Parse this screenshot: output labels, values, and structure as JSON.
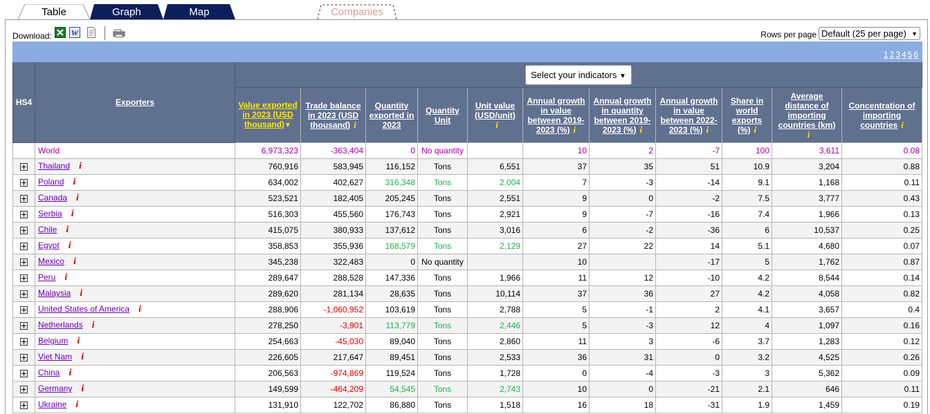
{
  "tabs": [
    {
      "label": "Table"
    },
    {
      "label": "Graph"
    },
    {
      "label": "Map"
    },
    {
      "label": "Companies"
    }
  ],
  "toolbar": {
    "download_label": "Download:",
    "rows_per_page_label": "Rows per page",
    "rows_per_page_value": "Default (25 per page)"
  },
  "pagination": [
    "1",
    "2",
    "3",
    "4",
    "5",
    "6"
  ],
  "select_indicators_label": "Select your indicators",
  "headers": {
    "hs4": "HS4",
    "exporters": "Exporters",
    "value_exported": "Value exported in 2023 (USD thousand)",
    "trade_balance": "Trade balance in 2023 (USD thousand)",
    "quantity_exported": "Quantity exported in 2023",
    "quantity_unit": "Quantity Unit",
    "unit_value": "Unit value (USD/unit)",
    "growth_value": "Annual growth in value between 2019-2023 (%)",
    "growth_quantity": "Annual growth in quantity between 2019-2023 (%)",
    "growth_value_2022": "Annual growth in value between 2022-2023 (%)",
    "share_world": "Share in world exports (%)",
    "avg_distance": "Average distance of importing countries (km)",
    "concentration": "Concentration of importing countries"
  },
  "colors": {
    "header_bg": "#60708f",
    "pager_bg": "#8aace1",
    "world_text": "#a200a6",
    "negative": "#e00000",
    "estimated": "#22b14c",
    "link": "#6b00b1",
    "sort_highlight": "#ffe600"
  },
  "rows": [
    {
      "name": "World",
      "value": "6,973,323",
      "balance": "-363,404",
      "qty": "0",
      "unit": "No quantity",
      "uv": "",
      "g1": "10",
      "g2": "2",
      "g3": "-7",
      "share": "100",
      "dist": "3,611",
      "conc": "0.08"
    },
    {
      "name": "Thailand",
      "value": "760,916",
      "balance": "583,945",
      "qty": "116,152",
      "unit": "Tons",
      "uv": "6,551",
      "g1": "37",
      "g2": "35",
      "g3": "51",
      "share": "10.9",
      "dist": "3,204",
      "conc": "0.88"
    },
    {
      "name": "Poland",
      "value": "634,002",
      "balance": "402,627",
      "qty": "316,348",
      "unit": "Tons",
      "uv": "2,004",
      "g1": "7",
      "g2": "-3",
      "g3": "-14",
      "share": "9.1",
      "dist": "1,168",
      "conc": "0.11"
    },
    {
      "name": "Canada",
      "value": "523,521",
      "balance": "182,405",
      "qty": "205,245",
      "unit": "Tons",
      "uv": "2,551",
      "g1": "9",
      "g2": "0",
      "g3": "-2",
      "share": "7.5",
      "dist": "3,777",
      "conc": "0.43"
    },
    {
      "name": "Serbia",
      "value": "516,303",
      "balance": "455,560",
      "qty": "176,743",
      "unit": "Tons",
      "uv": "2,921",
      "g1": "9",
      "g2": "-7",
      "g3": "-16",
      "share": "7.4",
      "dist": "1,966",
      "conc": "0.13"
    },
    {
      "name": "Chile",
      "value": "415,075",
      "balance": "380,933",
      "qty": "137,612",
      "unit": "Tons",
      "uv": "3,016",
      "g1": "6",
      "g2": "-2",
      "g3": "-36",
      "share": "6",
      "dist": "10,537",
      "conc": "0.25"
    },
    {
      "name": "Egypt",
      "value": "358,853",
      "balance": "355,936",
      "qty": "168,579",
      "unit": "Tons",
      "uv": "2,129",
      "g1": "27",
      "g2": "22",
      "g3": "14",
      "share": "5.1",
      "dist": "4,680",
      "conc": "0.07"
    },
    {
      "name": "Mexico",
      "value": "345,238",
      "balance": "322,483",
      "qty": "0",
      "unit": "No quantity",
      "uv": "",
      "g1": "10",
      "g2": "",
      "g3": "-17",
      "share": "5",
      "dist": "1,762",
      "conc": "0.87"
    },
    {
      "name": "Peru",
      "value": "289,647",
      "balance": "288,528",
      "qty": "147,336",
      "unit": "Tons",
      "uv": "1,966",
      "g1": "11",
      "g2": "12",
      "g3": "-10",
      "share": "4.2",
      "dist": "8,544",
      "conc": "0.14"
    },
    {
      "name": "Malaysia",
      "value": "289,620",
      "balance": "281,134",
      "qty": "28,635",
      "unit": "Tons",
      "uv": "10,114",
      "g1": "37",
      "g2": "36",
      "g3": "27",
      "share": "4.2",
      "dist": "4,058",
      "conc": "0.82"
    },
    {
      "name": "United States of America",
      "value": "288,906",
      "balance": "-1,060,952",
      "qty": "103,619",
      "unit": "Tons",
      "uv": "2,788",
      "g1": "5",
      "g2": "-1",
      "g3": "2",
      "share": "4.1",
      "dist": "3,657",
      "conc": "0.4"
    },
    {
      "name": "Netherlands",
      "value": "278,250",
      "balance": "-3,901",
      "qty": "113,779",
      "unit": "Tons",
      "uv": "2,446",
      "g1": "5",
      "g2": "-3",
      "g3": "12",
      "share": "4",
      "dist": "1,097",
      "conc": "0.16"
    },
    {
      "name": "Belgium",
      "value": "254,663",
      "balance": "-45,030",
      "qty": "89,040",
      "unit": "Tons",
      "uv": "2,860",
      "g1": "11",
      "g2": "3",
      "g3": "-6",
      "share": "3.7",
      "dist": "1,283",
      "conc": "0.12"
    },
    {
      "name": "Viet Nam",
      "value": "226,605",
      "balance": "217,647",
      "qty": "89,451",
      "unit": "Tons",
      "uv": "2,533",
      "g1": "36",
      "g2": "31",
      "g3": "0",
      "share": "3.2",
      "dist": "4,525",
      "conc": "0.26"
    },
    {
      "name": "China",
      "value": "206,563",
      "balance": "-974,869",
      "qty": "119,524",
      "unit": "Tons",
      "uv": "1,728",
      "g1": "0",
      "g2": "-4",
      "g3": "-3",
      "share": "3",
      "dist": "5,362",
      "conc": "0.09"
    },
    {
      "name": "Germany",
      "value": "149,599",
      "balance": "-464,209",
      "qty": "54,545",
      "unit": "Tons",
      "uv": "2,743",
      "g1": "10",
      "g2": "0",
      "g3": "-21",
      "share": "2.1",
      "dist": "646",
      "conc": "0.11"
    },
    {
      "name": "Ukraine",
      "value": "131,910",
      "balance": "122,702",
      "qty": "86,880",
      "unit": "Tons",
      "uv": "1,518",
      "g1": "16",
      "g2": "18",
      "g3": "-31",
      "share": "1.9",
      "dist": "1,459",
      "conc": "0.19"
    }
  ],
  "estimated_rows": [
    "Poland",
    "Egypt",
    "Netherlands",
    "Germany"
  ]
}
